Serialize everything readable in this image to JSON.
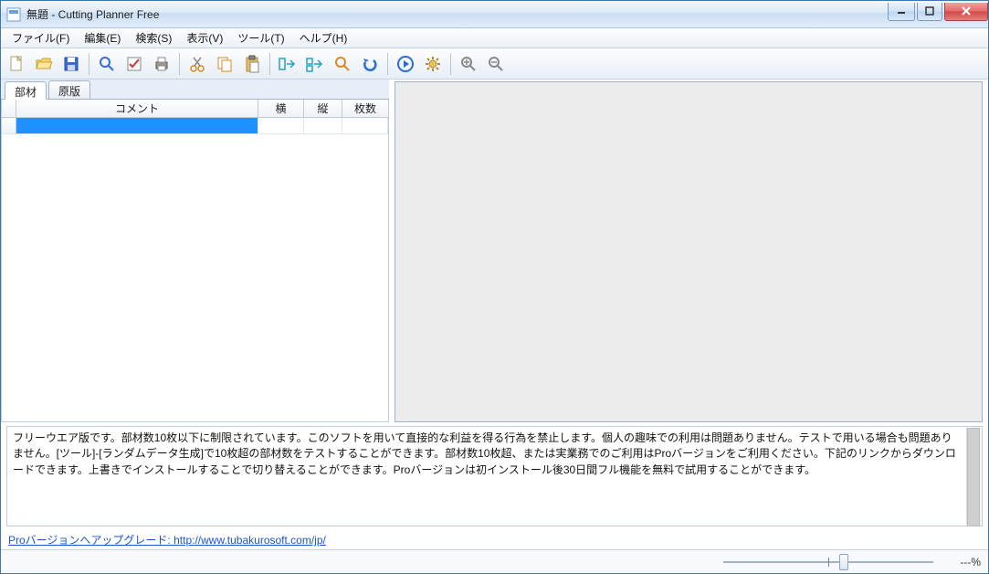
{
  "window": {
    "title": "無題 - Cutting Planner Free"
  },
  "menu": {
    "file": "ファイル(F)",
    "edit": "編集(E)",
    "search": "検索(S)",
    "view": "表示(V)",
    "tool": "ツール(T)",
    "help": "ヘルプ(H)"
  },
  "toolbar": {
    "icons": [
      "new-file-icon",
      "open-folder-icon",
      "save-icon",
      "sep",
      "find-icon",
      "options-icon",
      "print-icon",
      "sep",
      "cut-icon",
      "copy-icon",
      "paste-icon",
      "sep",
      "arrange-left-icon",
      "arrange-right-icon",
      "search-small-icon",
      "undo-icon",
      "sep",
      "play-icon",
      "gear-icon",
      "sep",
      "zoom-in-icon",
      "zoom-out-icon"
    ]
  },
  "tabs": {
    "parts": "部材",
    "sheets": "原版"
  },
  "grid": {
    "headers": {
      "comment": "コメント",
      "width": "横",
      "height": "縦",
      "count": "枚数"
    },
    "rows": [
      {
        "comment": "",
        "width": "",
        "height": "",
        "count": ""
      }
    ],
    "selected_row": 0
  },
  "info": {
    "text": "フリーウエア版です。部材数10枚以下に制限されています。このソフトを用いて直接的な利益を得る行為を禁止します。個人の趣味での利用は問題ありません。テストで用いる場合も問題ありません。[ツール]-[ランダムデータ生成]で10枚超の部材数をテストすることができます。部材数10枚超、または実業務でのご利用はProバージョンをご利用ください。下記のリンクからダウンロードできます。上書きでインストールすることで切り替えることができます。Proバージョンは初インストール後30日間フル機能を無料で試用することができます。"
  },
  "link": {
    "label": "Proバージョンへアップグレード: http://www.tubakurosoft.com/jp/"
  },
  "status": {
    "percent": "---%"
  }
}
